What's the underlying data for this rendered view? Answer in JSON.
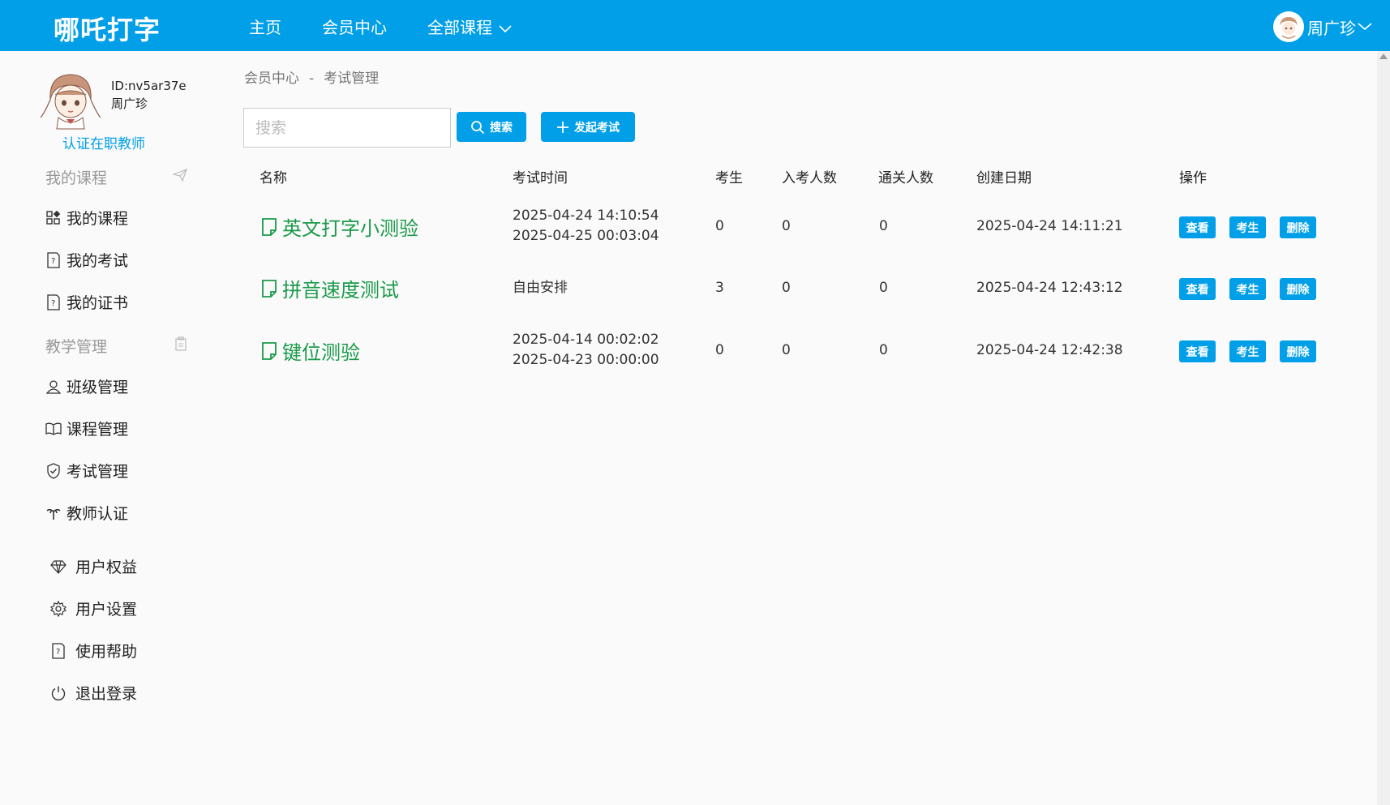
{
  "header": {
    "logo": "哪吒打字",
    "nav": [
      {
        "label": "主页"
      },
      {
        "label": "会员中心"
      },
      {
        "label": "全部课程"
      }
    ],
    "user_name": "周广珍"
  },
  "profile": {
    "id": "ID:nv5ar37e",
    "name": "周广珍",
    "certify_link": "认证在职教师"
  },
  "sidebar": {
    "section_courses": "我的课程",
    "course_items": [
      {
        "label": "我的课程",
        "icon": "grid-icon"
      },
      {
        "label": "我的考试",
        "icon": "exam-doc-icon"
      },
      {
        "label": "我的证书",
        "icon": "certificate-doc-icon"
      }
    ],
    "section_teaching": "教学管理",
    "teaching_items": [
      {
        "label": "班级管理",
        "icon": "user-icon"
      },
      {
        "label": "课程管理",
        "icon": "book-icon"
      },
      {
        "label": "考试管理",
        "icon": "shield-check-icon"
      },
      {
        "label": "教师认证",
        "icon": "palm-tree-icon"
      }
    ],
    "account_items": [
      {
        "label": "用户权益",
        "icon": "diamond-icon"
      },
      {
        "label": "用户设置",
        "icon": "gear-icon"
      },
      {
        "label": "使用帮助",
        "icon": "help-doc-icon"
      },
      {
        "label": "退出登录",
        "icon": "power-icon"
      }
    ]
  },
  "breadcrumb": {
    "parent": "会员中心",
    "separator": "-",
    "current": "考试管理"
  },
  "toolbar": {
    "search_placeholder": "搜索",
    "search_value": "",
    "search_button": "搜索",
    "create_button": "发起考试"
  },
  "table": {
    "headers": [
      "名称",
      "考试时间",
      "考生",
      "入考人数",
      "通关人数",
      "创建日期",
      "操作"
    ],
    "rows": [
      {
        "name": "英文打字小测验",
        "time_line1": "2025-04-24 14:10:54",
        "time_line2": "2025-04-25 00:03:04",
        "students": "0",
        "entered": "0",
        "passed": "0",
        "created": "2025-04-24 14:11:21"
      },
      {
        "name": "拼音速度测试",
        "time_line1": "自由安排",
        "time_line2": "",
        "students": "3",
        "entered": "0",
        "passed": "0",
        "created": "2025-04-24 12:43:12"
      },
      {
        "name": "键位测验",
        "time_line1": "2025-04-14 00:02:02",
        "time_line2": "2025-04-23 00:00:00",
        "students": "0",
        "entered": "0",
        "passed": "0",
        "created": "2025-04-24 12:42:38"
      }
    ],
    "actions": {
      "view": "查看",
      "students": "考生",
      "delete": "删除"
    }
  },
  "colors": {
    "primary": "#009fe8",
    "exam_name": "#1a9a4a",
    "muted": "#999999"
  }
}
